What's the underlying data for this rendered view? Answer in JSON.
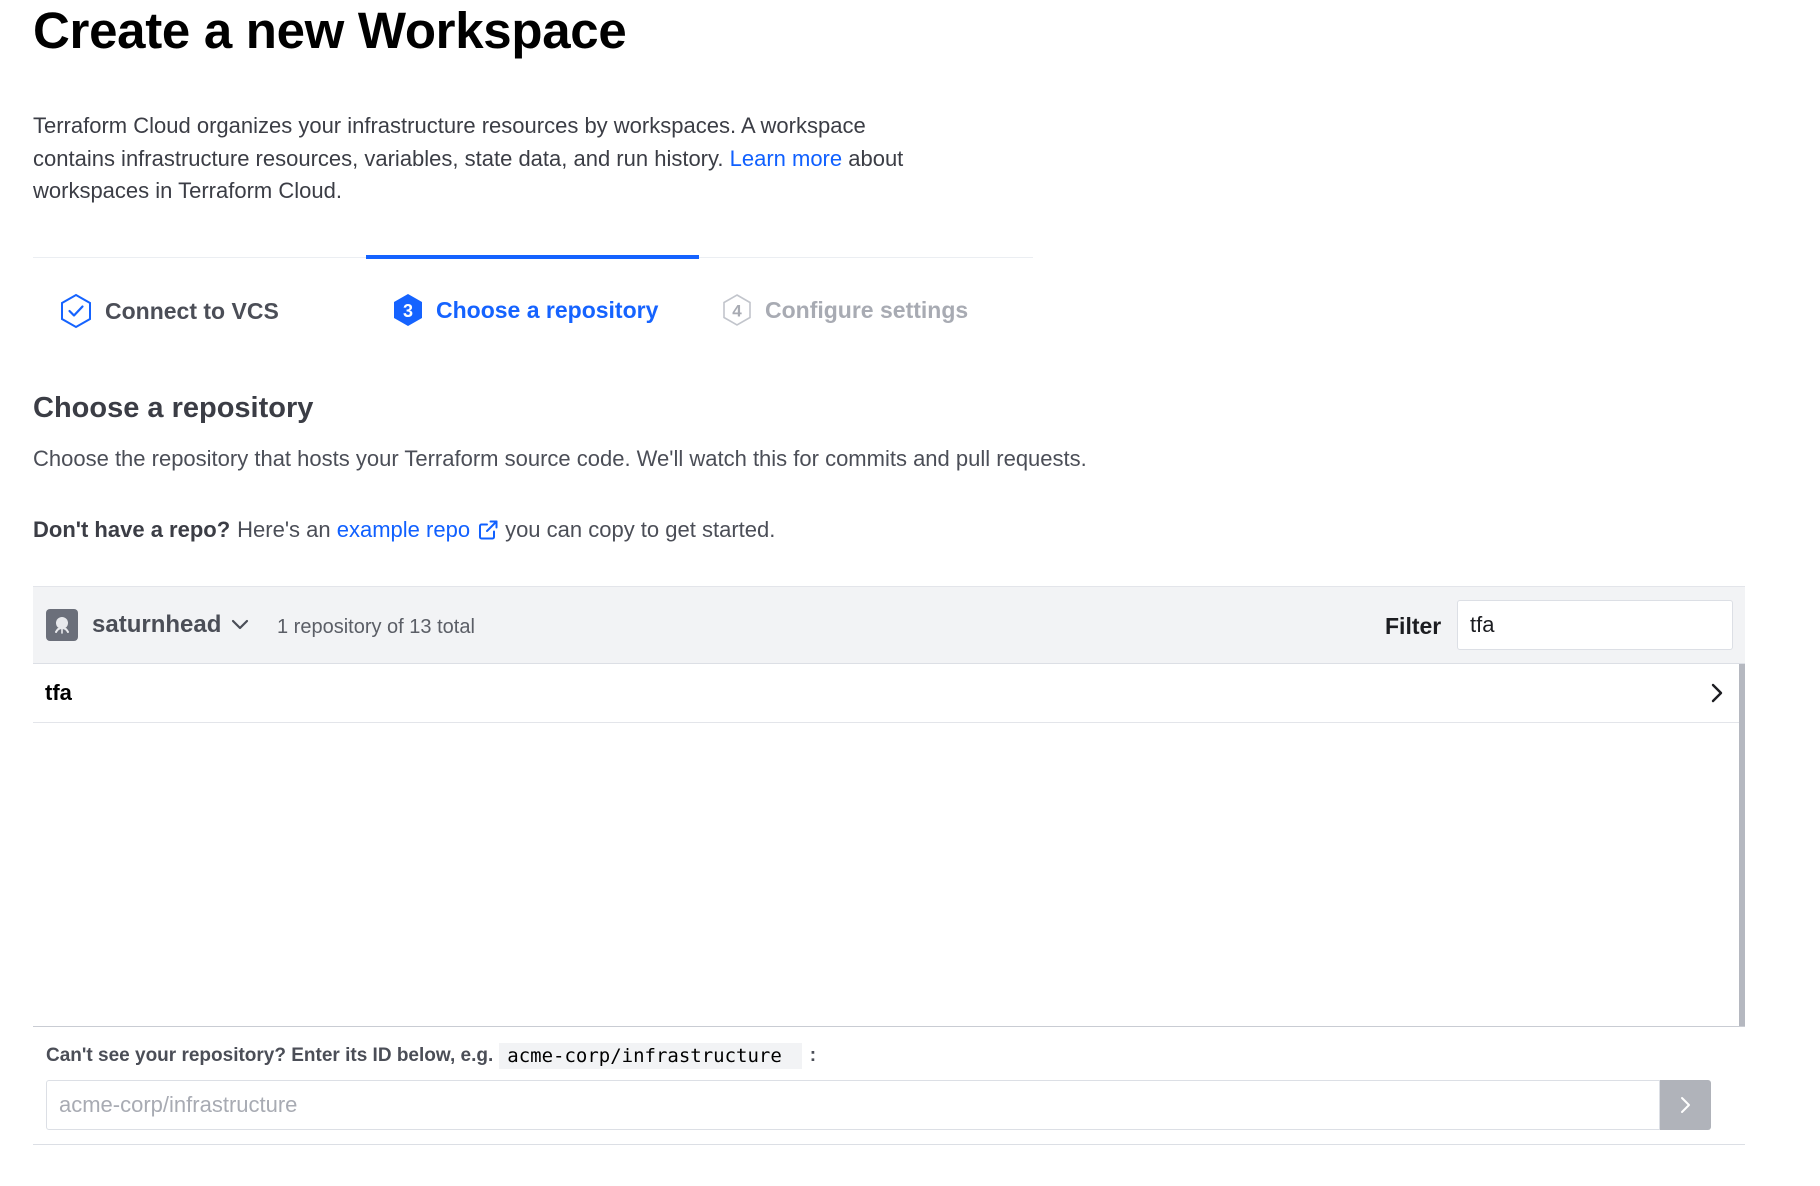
{
  "page": {
    "title": "Create a new Workspace",
    "intro_text": "Terraform Cloud organizes your infrastructure resources by workspaces. A workspace contains infrastructure resources, variables, state data, and run history. ",
    "intro_link": "Learn more",
    "intro_tail": " about workspaces in Terraform Cloud."
  },
  "steps": [
    {
      "label": "Connect to VCS",
      "state": "done",
      "icon": "check-hexagon-icon"
    },
    {
      "number": "3",
      "label": "Choose a repository",
      "state": "active"
    },
    {
      "number": "4",
      "label": "Configure settings",
      "state": "todo"
    }
  ],
  "section": {
    "heading": "Choose a repository",
    "description": "Choose the repository that hosts your Terraform source code. We'll watch this for commits and pull requests.",
    "no_repo_bold": "Don't have a repo?",
    "no_repo_text": "Here's an",
    "no_repo_link": "example repo",
    "no_repo_tail": "you can copy to get started."
  },
  "repo_panel": {
    "org_name": "saturnhead",
    "count_text": "1 repository of 13 total",
    "filter_label": "Filter",
    "filter_value": "tfa",
    "repos": [
      {
        "name": "tfa"
      }
    ],
    "cant_see_text": "Can't see your repository? Enter its ID below, e.g.",
    "example_id": "acme-corp/infrastructure",
    "colon": ":",
    "input_placeholder": "acme-corp/infrastructure",
    "input_value": ""
  },
  "colors": {
    "accent": "#1563ff",
    "link": "#1060ff",
    "muted": "#a8abb3"
  }
}
